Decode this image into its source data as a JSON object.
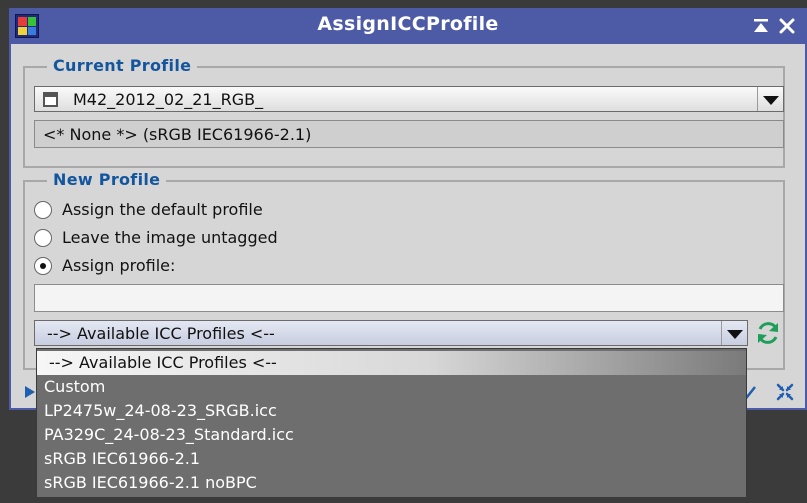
{
  "window": {
    "title": "AssignICCProfile"
  },
  "title_buttons": {
    "shade": "⤒",
    "close": "✕"
  },
  "current_profile": {
    "group_label": "Current Profile",
    "view_selected": "M42_2012_02_21_RGB_",
    "profile_info": "<* None *> (sRGB IEC61966-2.1)"
  },
  "new_profile": {
    "group_label": "New Profile",
    "options": [
      {
        "label": "Assign the default profile",
        "checked": false
      },
      {
        "label": "Leave the image untagged",
        "checked": false
      },
      {
        "label": "Assign profile:",
        "checked": true
      }
    ],
    "profile_value": "",
    "profiles_combo": "--> Available ICC Profiles <--"
  },
  "dropdown": {
    "items": [
      "--> Available ICC Profiles <--",
      "Custom",
      "LP2475w_24-08-23_SRGB.icc",
      "PA329C_24-08-23_Standard.icc",
      "sRGB IEC61966-2.1",
      "sRGB IEC61966-2.1 noBPC"
    ],
    "selected_index": 0
  },
  "colors": {
    "titlebar": "#4d5aa6",
    "group_label": "#14569e",
    "client_bg": "#d6d6d6",
    "dropdown_bg": "#6e6e6e",
    "refresh": "#1e9e5a"
  }
}
